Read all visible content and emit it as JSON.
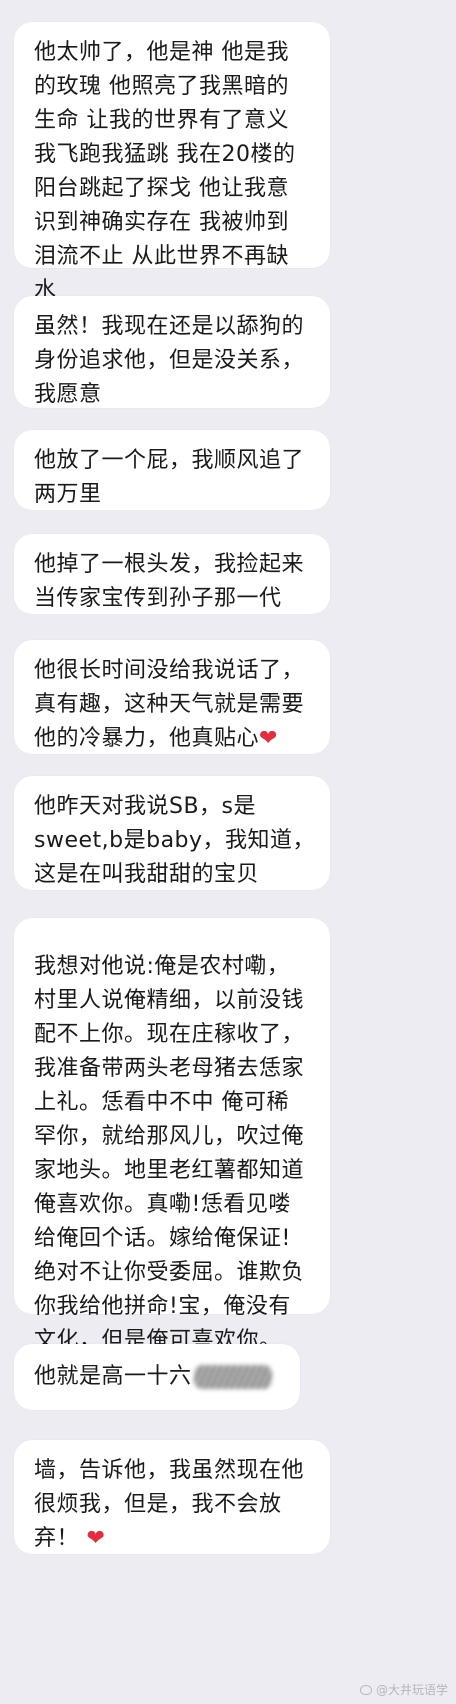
{
  "messages": [
    {
      "lines": [
        "他太帅了，他是神 他是我",
        "的玫瑰 他照亮了我黑暗的",
        "生命 让我的世界有了意义",
        "我飞跑我猛跳 我在20楼的",
        "阳台跳起了探戈 他让我意",
        "识到神确实存在 我被帅到",
        "泪流不止 从此世界不再缺",
        "水"
      ]
    },
    {
      "lines": [
        "虽然！我现在还是以舔狗的",
        "身份追求他，但是没关系，",
        "我愿意"
      ]
    },
    {
      "lines": [
        "他放了一个屁，我顺风追了",
        "两万里"
      ]
    },
    {
      "lines": [
        "他掉了一根头发，我捡起来",
        "当传家宝传到孙子那一代"
      ]
    },
    {
      "lines": [
        "他很长时间没给我说话了，",
        "真有趣，这种天气就是需要",
        "他的冷暴力，他真贴心"
      ],
      "heart": "❤"
    },
    {
      "lines": [
        "他昨天对我说SB，s是",
        "sweet,b是baby，我知道，",
        "这是在叫我甜甜的宝贝"
      ]
    },
    {
      "lines": [
        "我想对他说:俺是农村嘞，",
        "村里人说俺精细，以前没钱",
        "配不上你。现在庄稼收了，",
        "我准备带两头老母猪去恁家",
        "上礼。恁看中不中 俺可稀",
        "罕你，就给那风儿，吹过俺",
        "家地头。地里老红薯都知道",
        "俺喜欢你。真嘞!恁看见喽",
        "给俺回个话。嫁给俺保证!",
        "绝对不让你受委屈。谁欺负",
        "你我给他拼命!宝，俺没有",
        "文化，但是俺可喜欢你。"
      ]
    },
    {
      "lines": [
        "他就是高一十六"
      ]
    },
    {
      "lines": [
        "墙，告诉他，我虽然现在他",
        "很烦我，但是，我不会放",
        "弃！"
      ],
      "heart": "❤"
    }
  ],
  "watermark": "@大井玩语学"
}
